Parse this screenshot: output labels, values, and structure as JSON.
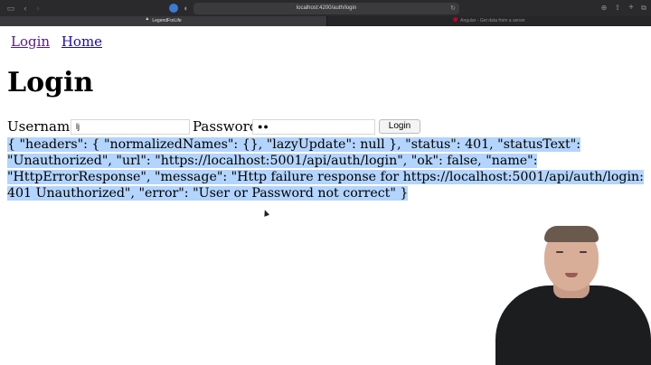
{
  "browser": {
    "url": "localhost:4200/auth/login",
    "tabs": [
      {
        "label": "LegendForLife",
        "active": true
      },
      {
        "label": "Angular - Get data from a server",
        "active": false
      }
    ]
  },
  "nav": {
    "login_label": "Login",
    "home_label": "Home"
  },
  "page": {
    "title": "Login"
  },
  "form": {
    "username_label": "Username:",
    "username_value": "lj",
    "password_label": "Password:",
    "password_value": "●●",
    "submit_label": "Login"
  },
  "error": {
    "text": "{ \"headers\": { \"normalizedNames\": {}, \"lazyUpdate\": null }, \"status\": 401, \"statusText\": \"Unauthorized\", \"url\": \"https://localhost:5001/api/auth/login\", \"ok\": false, \"name\": \"HttpErrorResponse\", \"message\": \"Http failure response for https://localhost:5001/api/auth/login: 401 Unauthorized\", \"error\": \"User or Password not correct\" }",
    "highlight_color": "#b3d4fc"
  },
  "colors": {
    "chrome_bg": "#2a2a2c",
    "link": "#1a0dab",
    "link_visited": "#551a8b"
  }
}
